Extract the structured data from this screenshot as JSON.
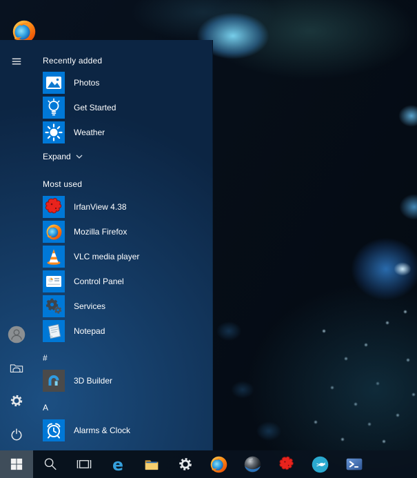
{
  "colors": {
    "accent_tile": "#0078d7",
    "gray_tile": "#4a4a4a",
    "menu_bg_dark": "#0c2543",
    "menu_bg_light": "#1c4f82",
    "taskbar_bg": "rgba(10,19,31,0.84)",
    "start_button_highlight": "#3f4d5a",
    "text": "#ffffff"
  },
  "start_menu": {
    "recently_added": {
      "header": "Recently added",
      "items": [
        {
          "label": "Photos",
          "icon": "photos-icon"
        },
        {
          "label": "Get Started",
          "icon": "lightbulb-icon"
        },
        {
          "label": "Weather",
          "icon": "sun-icon"
        }
      ]
    },
    "expand_label": "Expand",
    "most_used": {
      "header": "Most used",
      "items": [
        {
          "label": "IrfanView 4.38",
          "icon": "irfanview-icon"
        },
        {
          "label": "Mozilla Firefox",
          "icon": "firefox-icon"
        },
        {
          "label": "VLC media player",
          "icon": "vlc-cone-icon"
        },
        {
          "label": "Control Panel",
          "icon": "control-panel-icon"
        },
        {
          "label": "Services",
          "icon": "gears-icon"
        },
        {
          "label": "Notepad",
          "icon": "notepad-icon"
        }
      ]
    },
    "alpha_list": [
      {
        "letter": "#",
        "items": [
          {
            "label": "3D Builder",
            "icon": "3d-builder-icon"
          }
        ]
      },
      {
        "letter": "A",
        "items": [
          {
            "label": "Alarms & Clock",
            "icon": "alarm-clock-icon"
          }
        ]
      }
    ],
    "rail_icons": [
      "hamburger-icon",
      "user-avatar",
      "file-explorer-icon",
      "settings-gear-icon",
      "power-icon"
    ]
  },
  "taskbar_icons": [
    "start-windows-icon",
    "search-icon",
    "task-view-icon",
    "edge-icon",
    "file-explorer-icon",
    "settings-gear-icon",
    "firefox-icon",
    "globe-app-icon",
    "irfanview-icon",
    "cyan-circle-app-icon",
    "powershell-icon"
  ],
  "desktop_icons": [
    "firefox-icon"
  ]
}
